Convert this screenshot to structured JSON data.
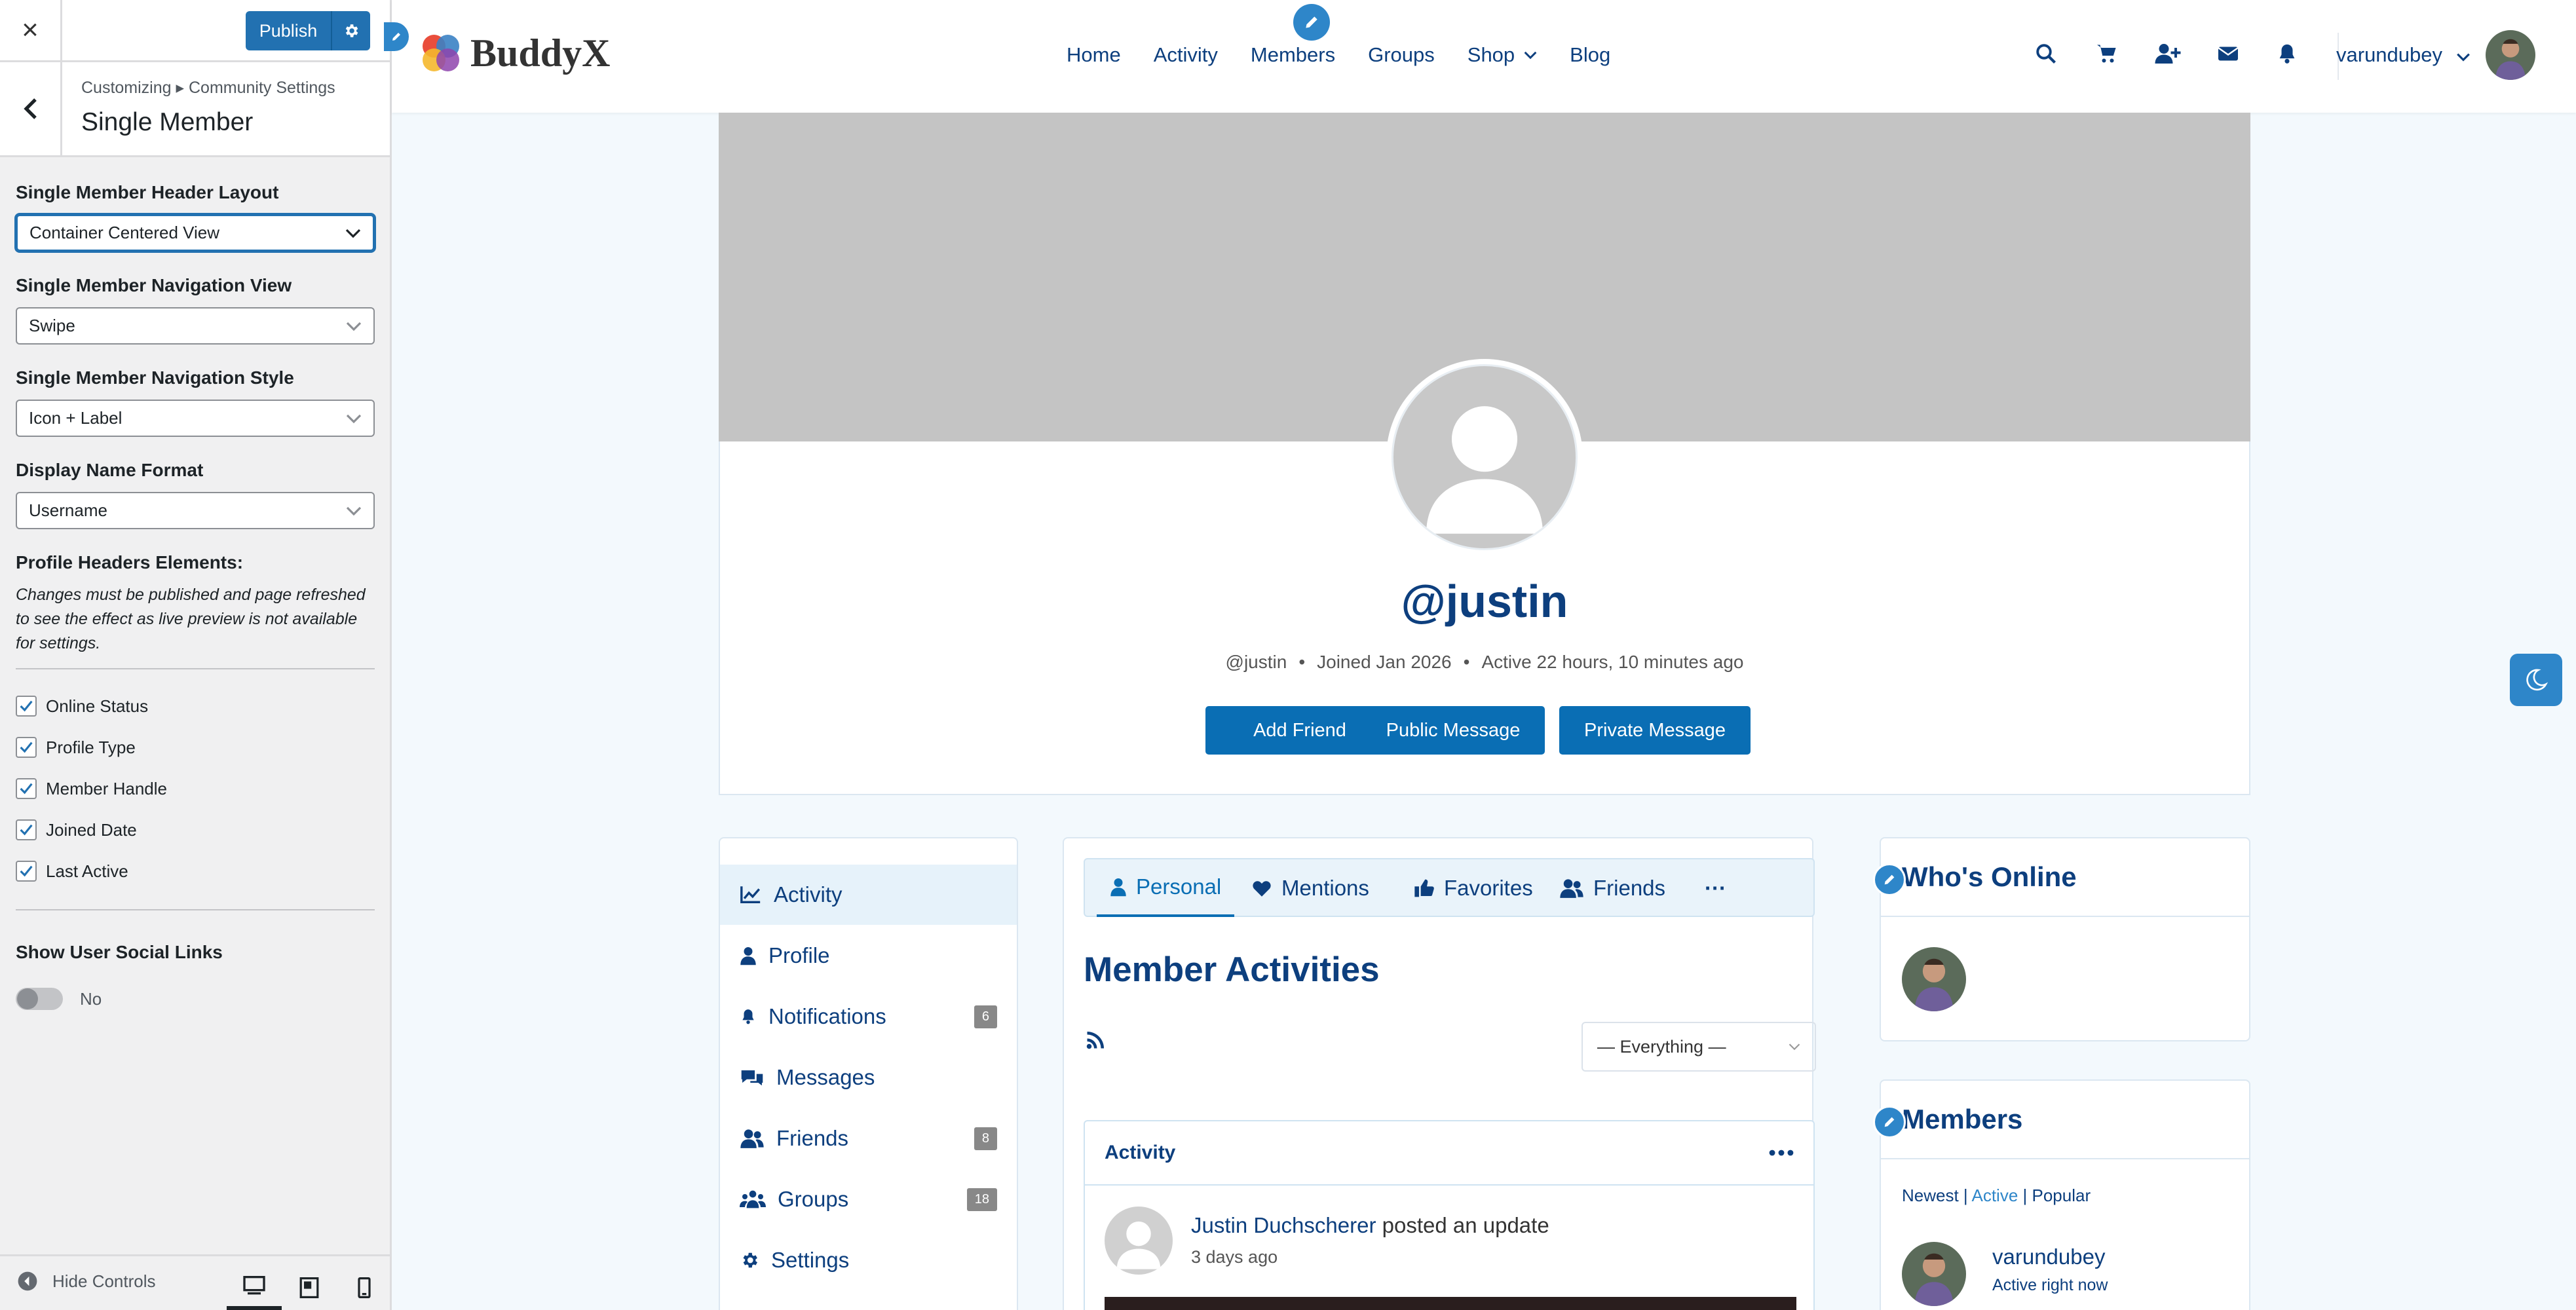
{
  "customizer": {
    "close_label": "×",
    "publish_label": "Publish",
    "breadcrumb": "Customizing ▸ Community Settings",
    "section_title": "Single Member",
    "header_layout": {
      "label": "Single Member Header Layout",
      "value": "Container Centered View"
    },
    "nav_view": {
      "label": "Single Member Navigation View",
      "value": "Swipe"
    },
    "nav_style": {
      "label": "Single Member Navigation Style",
      "value": "Icon + Label"
    },
    "display_name": {
      "label": "Display Name Format",
      "value": "Username"
    },
    "elements_heading": "Profile Headers Elements:",
    "elements_note": "Changes must be published and page refreshed to see the effect as live preview is not available for settings.",
    "checkboxes": [
      {
        "label": "Online Status",
        "checked": true
      },
      {
        "label": "Profile Type",
        "checked": true
      },
      {
        "label": "Member Handle",
        "checked": true
      },
      {
        "label": "Joined Date",
        "checked": true
      },
      {
        "label": "Last Active",
        "checked": true
      }
    ],
    "social_links": {
      "label": "Show User Social Links",
      "state": "No"
    },
    "hide_controls": "Hide Controls"
  },
  "site": {
    "logo_text": "BuddyX",
    "nav": [
      "Home",
      "Activity",
      "Members",
      "Groups",
      "Shop",
      "Blog"
    ],
    "username": "varundubey",
    "colors": {
      "primary": "#0d3f7e",
      "accent": "#2e86c9",
      "button": "#0a6eb4"
    }
  },
  "profile": {
    "handle": "@justin",
    "meta_handle": "@justin",
    "joined": "Joined Jan 2026",
    "active": "Active 22 hours, 10 minutes ago",
    "buttons": [
      "Add Friend",
      "Public Message",
      "Private Message"
    ]
  },
  "member_nav": [
    {
      "label": "Activity",
      "icon": "chart-line-icon",
      "active": true
    },
    {
      "label": "Profile",
      "icon": "user-icon"
    },
    {
      "label": "Notifications",
      "icon": "bell-icon",
      "badge": "6"
    },
    {
      "label": "Messages",
      "icon": "comments-icon"
    },
    {
      "label": "Friends",
      "icon": "users-icon",
      "badge": "8"
    },
    {
      "label": "Groups",
      "icon": "group-icon",
      "badge": "18"
    },
    {
      "label": "Settings",
      "icon": "gear-icon"
    }
  ],
  "activity": {
    "tabs": [
      "Personal",
      "Mentions",
      "Favorites",
      "Friends",
      "···"
    ],
    "heading": "Member Activities",
    "filter": "— Everything —",
    "box_title": "Activity",
    "author": "Justin Duchscherer",
    "verb": "posted an update",
    "time": "3 days ago"
  },
  "widgets": {
    "online_title": "Who's Online",
    "members_title": "Members",
    "tabs": {
      "newest": "Newest",
      "sep": " | ",
      "active": "Active",
      "popular": "Popular"
    },
    "member_name": "varundubey",
    "member_status": "Active right now"
  }
}
